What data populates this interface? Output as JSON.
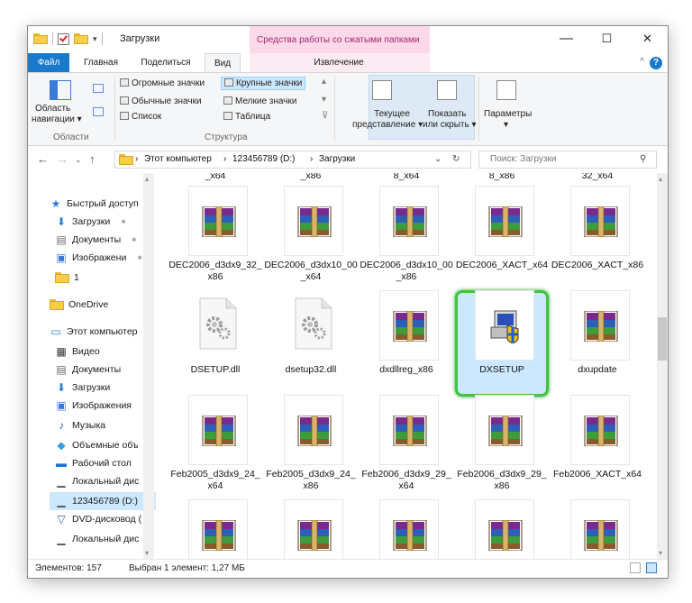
{
  "window": {
    "title": "Загрузки",
    "context_tab_header": "Средства работы со сжатыми папками",
    "controls": {
      "minimize": "—",
      "maximize": "☐",
      "close": "✕"
    }
  },
  "ribbon_tabs": {
    "file": "Файл",
    "home": "Главная",
    "share": "Поделиться",
    "view": "Вид",
    "extract": "Извлечение"
  },
  "ribbon": {
    "areas": {
      "nav_pane_line1": "Область",
      "nav_pane_line2": "навигации ▾",
      "group_label": "Области"
    },
    "layout": {
      "huge_icons": "Огромные значки",
      "large_icons": "Крупные значки",
      "normal_icons": "Обычные значки",
      "small_icons": "Мелкие значки",
      "list": "Список",
      "table": "Таблица",
      "group_label": "Структура"
    },
    "current_view_line1": "Текущее",
    "current_view_line2": "представление ▾",
    "show_hide_line1": "Показать",
    "show_hide_line2": "или скрыть ▾",
    "options_line1": "Параметры",
    "options_line2": "▾"
  },
  "address": {
    "crumbs": [
      "Этот компьютер",
      "123456789 (D:)",
      "Загрузки"
    ],
    "separator": "›",
    "search_placeholder": "Поиск: Загрузки"
  },
  "nav": {
    "items": [
      {
        "label": "Быстрый доступ",
        "icon": "star-icon",
        "pinned": false
      },
      {
        "label": "Загрузки",
        "icon": "download-icon",
        "pinned": true
      },
      {
        "label": "Документы",
        "icon": "documents-icon",
        "pinned": true
      },
      {
        "label": "Изображени",
        "icon": "pictures-icon",
        "pinned": true
      },
      {
        "label": "1",
        "icon": "folder-icon",
        "pinned": false
      },
      {
        "label": "OneDrive",
        "icon": "onedrive-icon",
        "pinned": false
      },
      {
        "label": "Этот компьютер",
        "icon": "computer-icon",
        "pinned": false
      },
      {
        "label": "Видео",
        "icon": "video-icon",
        "pinned": false
      },
      {
        "label": "Документы",
        "icon": "documents-icon",
        "pinned": false
      },
      {
        "label": "Загрузки",
        "icon": "download-icon",
        "pinned": false
      },
      {
        "label": "Изображения",
        "icon": "pictures-icon",
        "pinned": false
      },
      {
        "label": "Музыка",
        "icon": "music-icon",
        "pinned": false
      },
      {
        "label": "Объемные объ",
        "icon": "3d-objects-icon",
        "pinned": false
      },
      {
        "label": "Рабочий стол",
        "icon": "desktop-icon",
        "pinned": false
      },
      {
        "label": "Локальный дис",
        "icon": "drive-icon",
        "pinned": false
      },
      {
        "label": "123456789 (D:)",
        "icon": "drive-icon",
        "pinned": false
      },
      {
        "label": "DVD-дисковод (",
        "icon": "dvd-icon",
        "pinned": false
      },
      {
        "label": "Локальный дис",
        "icon": "drive-icon",
        "pinned": false
      }
    ],
    "pin_glyph": "✶"
  },
  "files": {
    "top_partial": [
      "_x64",
      "_x86",
      "8_x64",
      "8_x86",
      "32_x64"
    ],
    "row1": [
      "DEC2006_d3dx9_32_x86",
      "DEC2006_d3dx10_00_x64",
      "DEC2006_d3dx10_00_x86",
      "DEC2006_XACT_x64",
      "DEC2006_XACT_x86"
    ],
    "row2": [
      "DSETUP.dll",
      "dsetup32.dll",
      "dxdllreg_x86",
      "DXSETUP",
      "dxupdate"
    ],
    "row3": [
      "Feb2005_d3dx9_24_x64",
      "Feb2005_d3dx9_24_x86",
      "Feb2006_d3dx9_29_x64",
      "Feb2006_d3dx9_29_x86",
      "Feb2006_XACT_x64"
    ]
  },
  "status": {
    "count": "Элементов: 157",
    "selection": "Выбран 1 элемент: 1,27 МБ"
  },
  "colors": {
    "accent": "#1979ca",
    "selection": "#cce8ff",
    "highlight": "#3fc43f"
  }
}
